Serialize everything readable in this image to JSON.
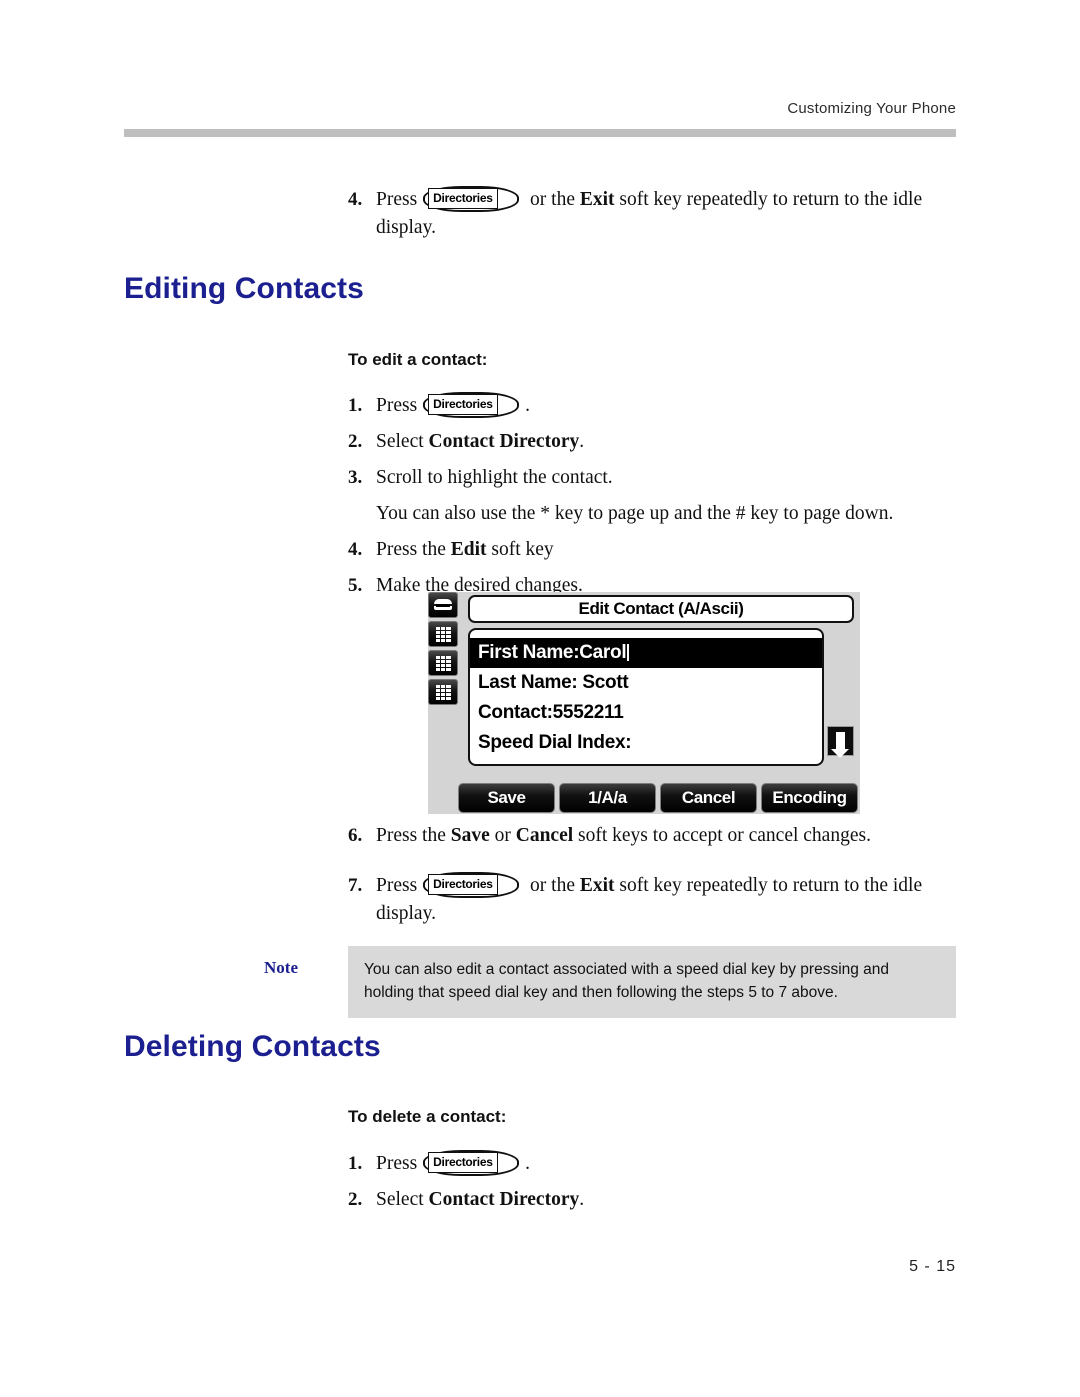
{
  "header": {
    "running_head": "Customizing Your Phone"
  },
  "top_step": {
    "number": "4.",
    "press_label": "Press",
    "hardkey": "Directories",
    "after": " or the ",
    "bold_key": "Exit",
    "tail": " soft key repeatedly to return to the idle display."
  },
  "sections": [
    {
      "heading": "Editing Contacts",
      "sub_heading": "To edit a contact:"
    },
    {
      "heading": "Deleting Contacts",
      "sub_heading": "To delete a contact:"
    }
  ],
  "edit_steps": {
    "s1_num": "1.",
    "s1_press": "Press",
    "s1_hardkey": "Directories",
    "s1_period": ".",
    "s2_num": "2.",
    "s2_lead": "Select ",
    "s2_bold": "Contact Directory",
    "s2_tail": ".",
    "s3_num": "3.",
    "s3_text": "Scroll to highlight the contact.",
    "s3_note": "You can also use the * key to page up and the # key to page down.",
    "s4_num": "4.",
    "s4_lead": "Press the ",
    "s4_bold": "Edit",
    "s4_tail": " soft key",
    "s5_num": "5.",
    "s5_text": "Make the desired changes.",
    "s6_num": "6.",
    "s6_lead": "Press the ",
    "s6_bold1": "Save",
    "s6_mid": " or ",
    "s6_bold2": "Cancel",
    "s6_tail": " soft keys to accept or cancel changes.",
    "s7_num": "7.",
    "s7_press": "Press",
    "s7_hardkey": "Directories",
    "s7_mid": " or the ",
    "s7_bold": "Exit",
    "s7_tail": " soft key repeatedly to return to the idle display."
  },
  "delete_steps": {
    "s1_num": "1.",
    "s1_press": "Press",
    "s1_hardkey": "Directories",
    "s1_period": ".",
    "s2_num": "2.",
    "s2_lead": "Select ",
    "s2_bold": "Contact Directory",
    "s2_tail": "."
  },
  "note": {
    "label": "Note",
    "text": "You can also edit a contact associated with a speed dial key by pressing and holding that speed dial key and then following the steps 5 to 7 above."
  },
  "lcd": {
    "title": "Edit Contact (A/Ascii)",
    "line_keys": [
      "handset-icon",
      "keypad-icon",
      "keypad-icon",
      "keypad-icon"
    ],
    "fields": [
      {
        "label": "First Name:",
        "value": "Carol",
        "selected": true
      },
      {
        "label": "Last Name: ",
        "value": "Scott",
        "selected": false
      },
      {
        "label": "Contact:",
        "value": "5552211",
        "selected": false
      },
      {
        "label": "Speed Dial Index:",
        "value": "",
        "selected": false
      }
    ],
    "scroll_indicator": "arrow-down-icon",
    "soft_keys": [
      "Save",
      "1/A/a",
      "Cancel",
      "Encoding"
    ]
  },
  "footer": {
    "page_number": "5 - 15"
  },
  "colors": {
    "heading_blue": "#1b1f8f",
    "rule_gray": "#bfbfbf",
    "note_bg": "#d9d9d9",
    "lcd_bg": "#d4d4d4"
  }
}
